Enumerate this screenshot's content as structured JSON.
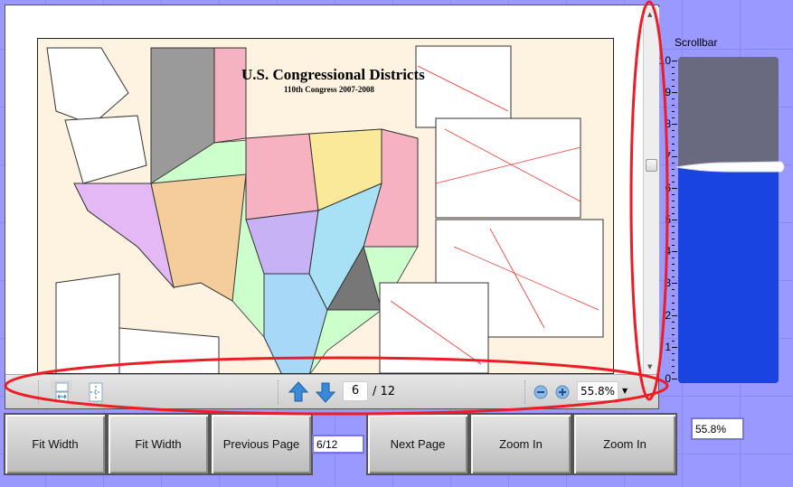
{
  "document": {
    "title": "U.S. Congressional Districts",
    "subtitle": "110th Congress 2007-2008"
  },
  "toolbar": {
    "current_page": "6",
    "total_pages": "/ 12",
    "zoom": "55.8%"
  },
  "buttons": {
    "fit_width_1": "Fit Width",
    "fit_width_2": "Fit Width",
    "previous_page": "Previous Page",
    "page_indicator": "6/12",
    "next_page": "Next Page",
    "zoom_in_1": "Zoom In",
    "zoom_in_2": "Zoom In"
  },
  "zoom_display": "55.8%",
  "slider": {
    "label": "Scrollbar",
    "min": 0,
    "max": 10,
    "value": 6.65,
    "ticks": [
      "10",
      "9",
      "8",
      "7",
      "6",
      "5",
      "4",
      "3",
      "2",
      "1",
      "0"
    ],
    "fill_color": "#1944e0",
    "track_color": "#696a80"
  },
  "annotation_color": "#ee1c24"
}
